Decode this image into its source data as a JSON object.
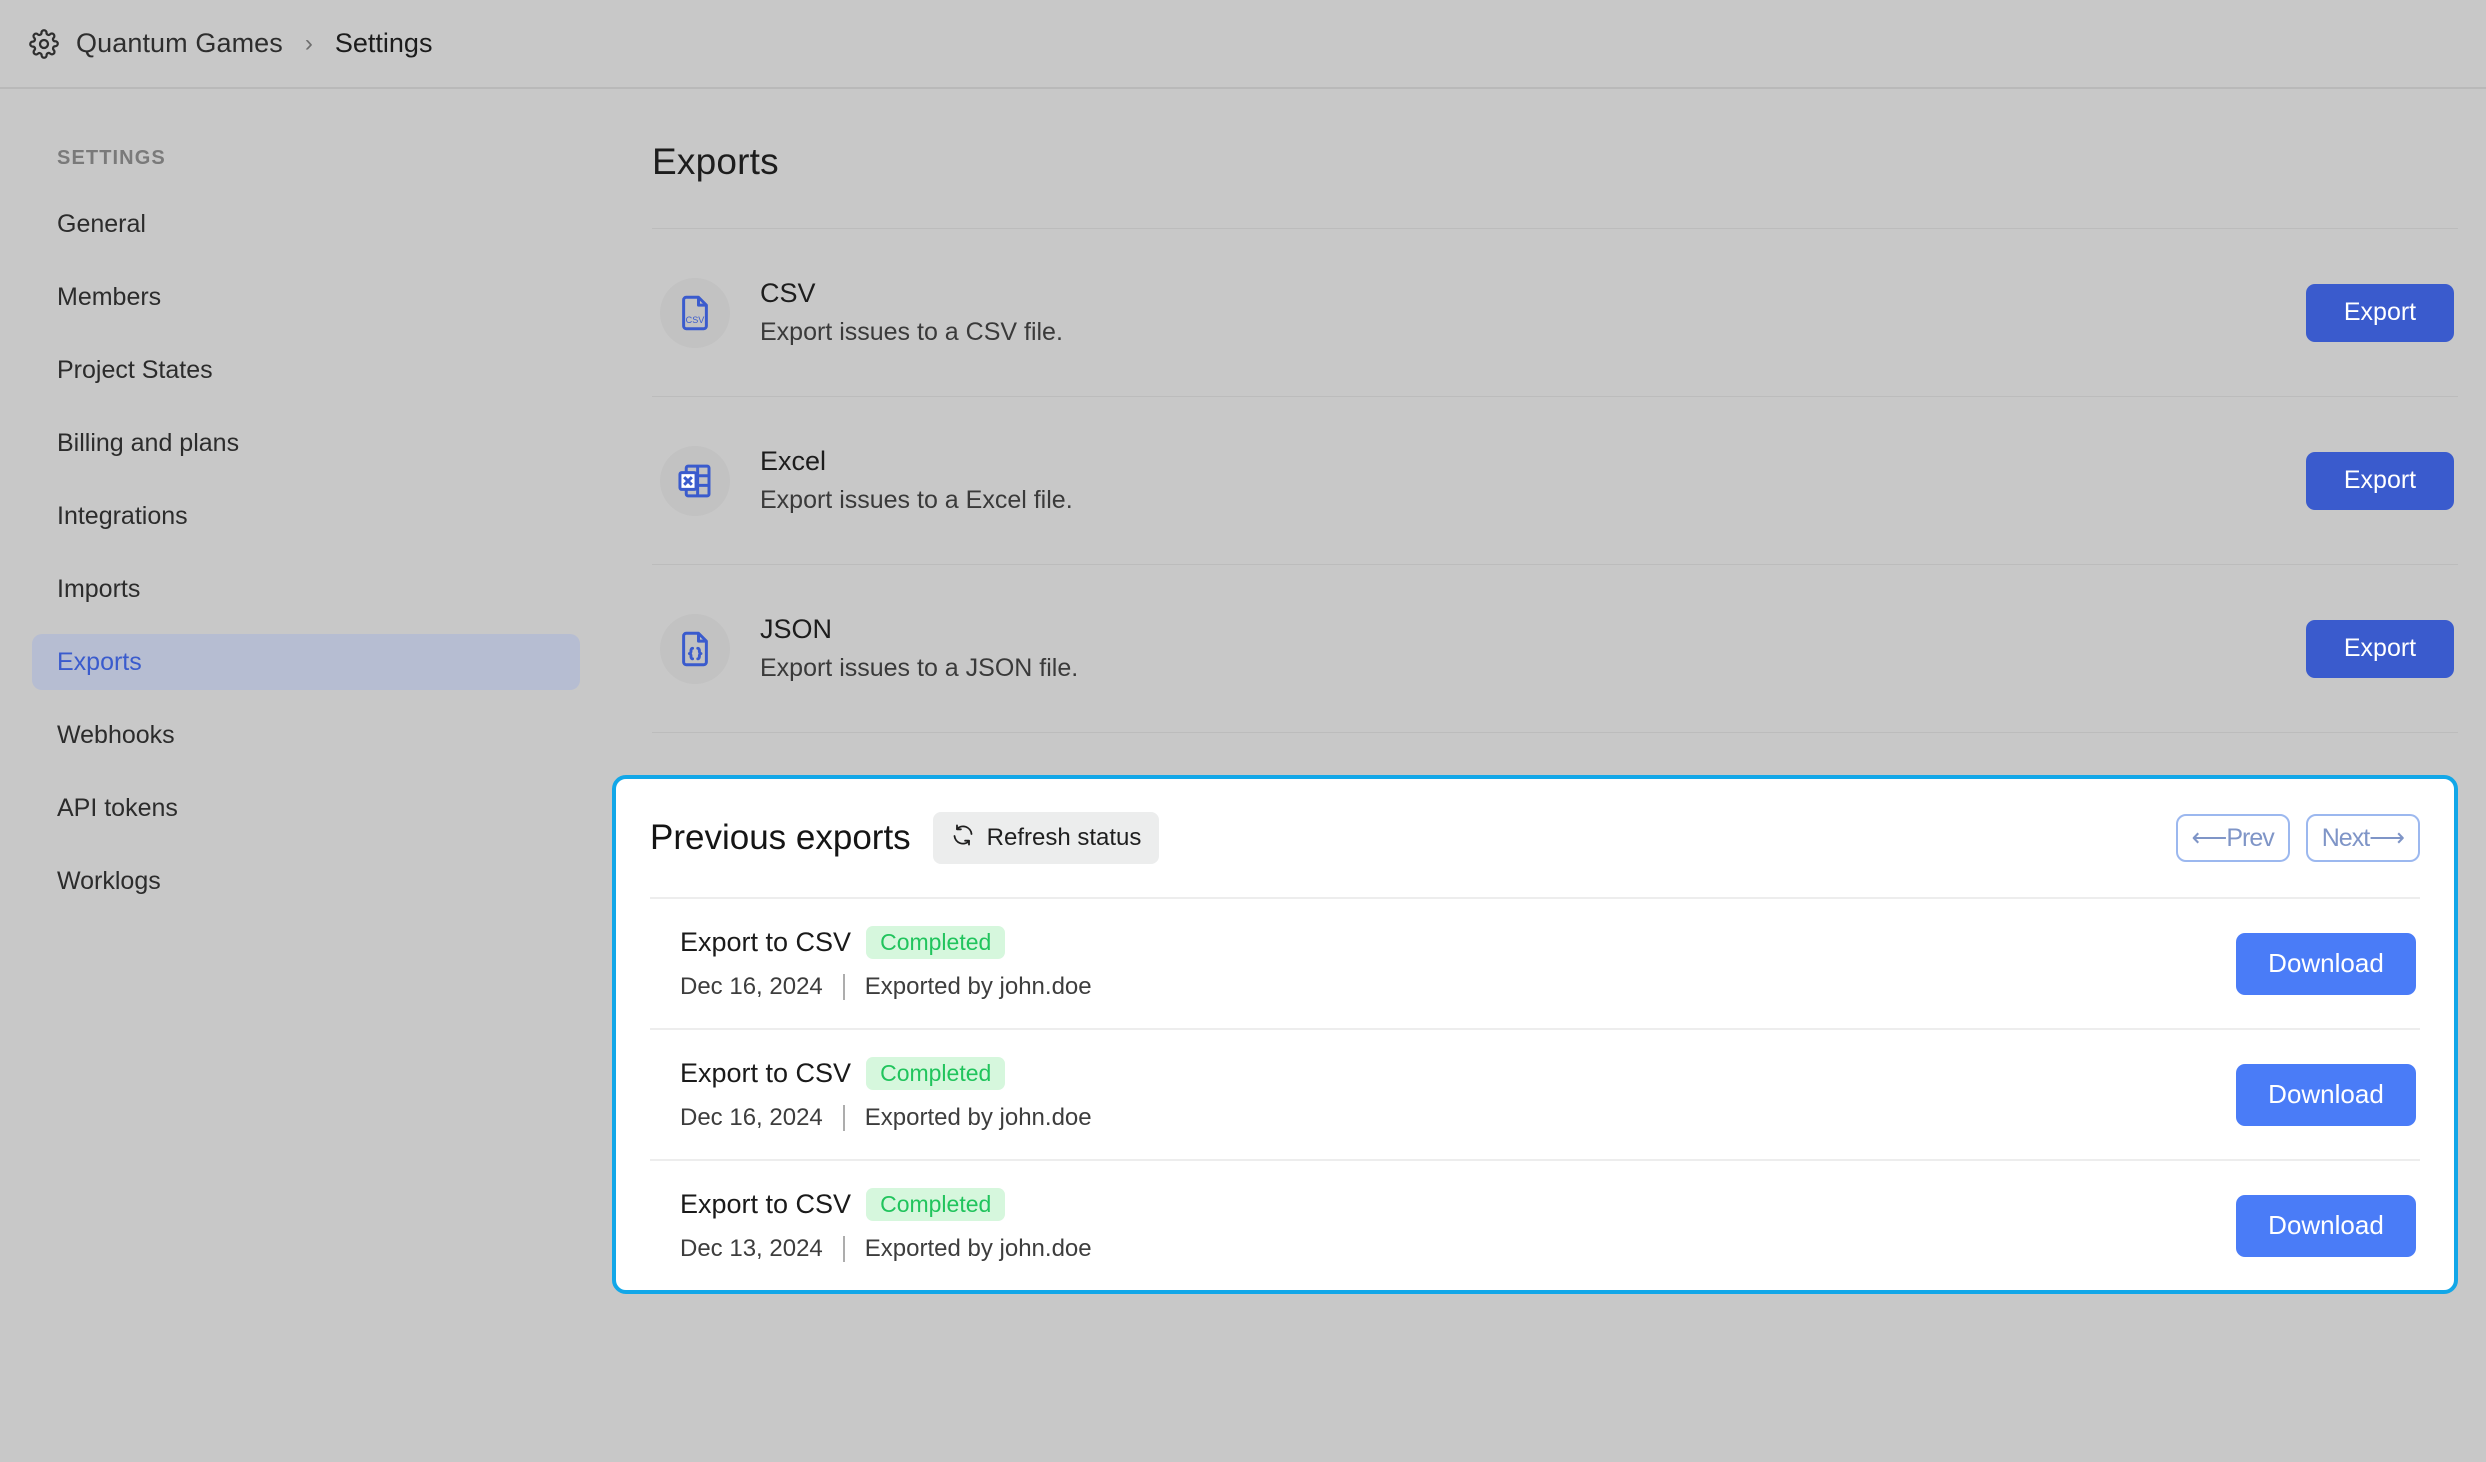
{
  "header": {
    "gear_icon": "gear-icon",
    "breadcrumb_root": "Quantum Games",
    "breadcrumb_separator": "›",
    "breadcrumb_current": "Settings"
  },
  "sidebar": {
    "section_label": "SETTINGS",
    "items": [
      {
        "label": "General",
        "active": false
      },
      {
        "label": "Members",
        "active": false
      },
      {
        "label": "Project States",
        "active": false
      },
      {
        "label": "Billing and plans",
        "active": false
      },
      {
        "label": "Integrations",
        "active": false
      },
      {
        "label": "Imports",
        "active": false
      },
      {
        "label": "Exports",
        "active": true
      },
      {
        "label": "Webhooks",
        "active": false
      },
      {
        "label": "API tokens",
        "active": false
      },
      {
        "label": "Worklogs",
        "active": false
      }
    ]
  },
  "main": {
    "title": "Exports",
    "export_options": [
      {
        "icon": "csv-file-icon",
        "name": "CSV",
        "description": "Export issues to a CSV file.",
        "button_label": "Export"
      },
      {
        "icon": "excel-file-icon",
        "name": "Excel",
        "description": "Export issues to a Excel file.",
        "button_label": "Export"
      },
      {
        "icon": "json-file-icon",
        "name": "JSON",
        "description": "Export issues to a JSON file.",
        "button_label": "Export"
      }
    ],
    "previous_exports": {
      "title": "Previous exports",
      "refresh_label": "Refresh status",
      "refresh_icon": "refresh-icon",
      "prev_label": "⟵Prev",
      "next_label": "Next⟶",
      "rows": [
        {
          "name": "Export to CSV",
          "status": "Completed",
          "date": "Dec 16, 2024",
          "exported_by": "Exported by john.doe",
          "button_label": "Download"
        },
        {
          "name": "Export to CSV",
          "status": "Completed",
          "date": "Dec 16, 2024",
          "exported_by": "Exported by john.doe",
          "button_label": "Download"
        },
        {
          "name": "Export to CSV",
          "status": "Completed",
          "date": "Dec 13, 2024",
          "exported_by": "Exported by john.doe",
          "button_label": "Download"
        }
      ]
    }
  },
  "colors": {
    "page_background": "#c8c8c8",
    "accent_blue": "#3a5bcd",
    "download_blue": "#4a7cf7",
    "panel_highlight": "#12a7e8",
    "status_green_text": "#21c45d",
    "status_green_bg": "#d6f7dd",
    "active_nav_bg": "#b6bdd2",
    "icon_blue": "#3a5bcd"
  }
}
